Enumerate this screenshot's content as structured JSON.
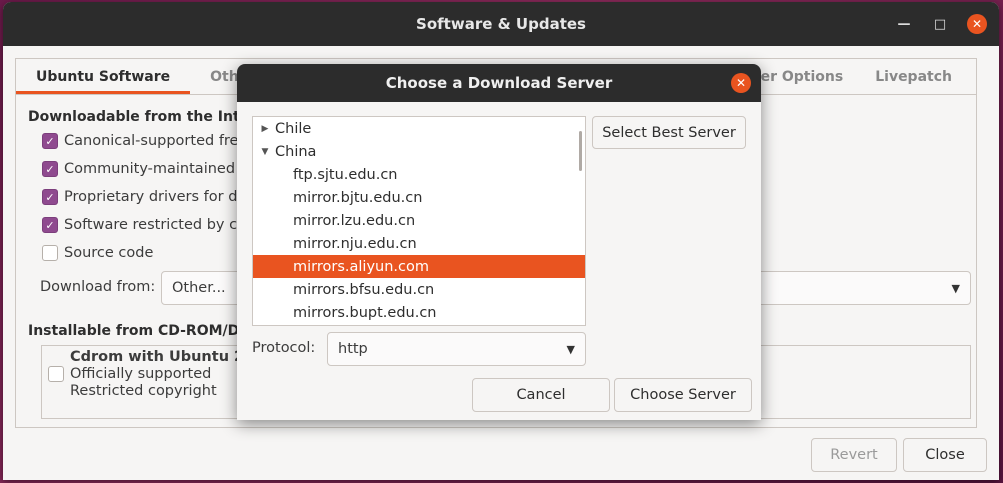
{
  "main_window": {
    "title": "Software & Updates",
    "tabs": [
      "Ubuntu Software",
      "Other",
      "eloper Options",
      "Livepatch"
    ],
    "downloadable_title": "Downloadable from the Inter",
    "checks": [
      {
        "label": "Canonical-supported free",
        "checked": true
      },
      {
        "label": "Community-maintained fre",
        "checked": true
      },
      {
        "label": "Proprietary drivers for dev",
        "checked": true
      },
      {
        "label": "Software restricted by cop",
        "checked": true
      },
      {
        "label": "Source code",
        "checked": false
      }
    ],
    "download_from_label": "Download from:",
    "download_from_value": "Other...",
    "installable_title": "Installable from CD-ROM/DVD",
    "cdrom": {
      "name": "Cdrom with Ubuntu 20.0",
      "line2": "Officially supported",
      "line3": "Restricted copyright"
    },
    "revert_label": "Revert",
    "close_label": "Close"
  },
  "dialog": {
    "title": "Choose a Download Server",
    "tree": [
      {
        "label": "Chile",
        "kind": "collapsed"
      },
      {
        "label": "China",
        "kind": "expanded"
      },
      {
        "label": "ftp.sjtu.edu.cn",
        "kind": "child"
      },
      {
        "label": "mirror.bjtu.edu.cn",
        "kind": "child"
      },
      {
        "label": "mirror.lzu.edu.cn",
        "kind": "child"
      },
      {
        "label": "mirror.nju.edu.cn",
        "kind": "child"
      },
      {
        "label": "mirrors.aliyun.com",
        "kind": "child",
        "selected": true
      },
      {
        "label": "mirrors.bfsu.edu.cn",
        "kind": "child"
      },
      {
        "label": "mirrors.bupt.edu.cn",
        "kind": "child"
      }
    ],
    "select_best_label": "Select Best Server",
    "protocol_label": "Protocol:",
    "protocol_value": "http",
    "cancel_label": "Cancel",
    "choose_label": "Choose Server"
  },
  "colors": {
    "accent": "#e95420",
    "checkbox": "#8f4a8f",
    "titlebar": "#2c2c2c"
  }
}
